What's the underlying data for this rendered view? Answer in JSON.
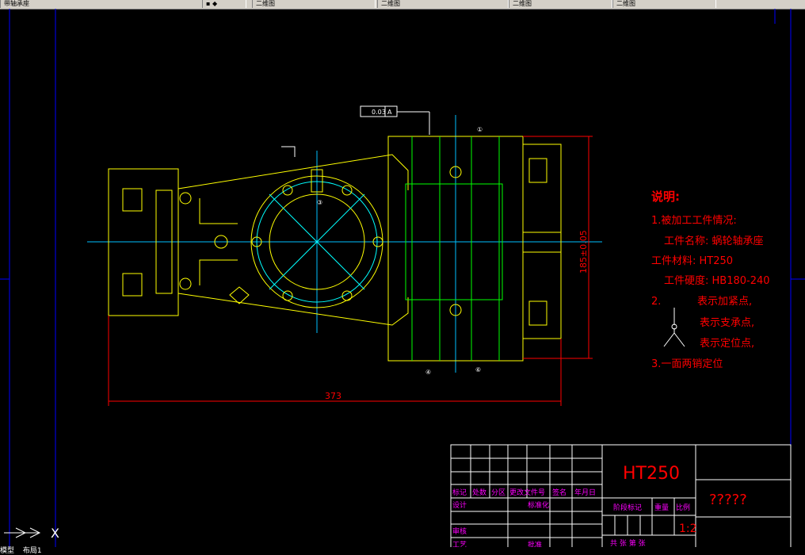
{
  "window_tabs": [
    {
      "label": "带轴承座"
    },
    {
      "label": "二维图"
    },
    {
      "label": "二维图"
    },
    {
      "label": "二维图"
    },
    {
      "label": "二维图"
    }
  ],
  "drawing": {
    "tolerance_frame": {
      "value": "0.03",
      "datum": "A"
    },
    "datum_marks": [
      "①",
      "④",
      "⑥",
      "③"
    ],
    "dimensions": {
      "overall_length": "373",
      "height": "185±0.05"
    }
  },
  "notes": {
    "heading": "说明:",
    "line1": "1.被加工工件情况:",
    "part_name": "工件名称: 蜗轮轴承座",
    "material": "工件材料: HT250",
    "hardness": "工件硬度: HB180-240",
    "item2": "2.",
    "clamp": "表示加紧点,",
    "support": "表示支承点,",
    "locate": "表示定位点,",
    "item3": "3.一面两销定位"
  },
  "title_block": {
    "material": "HT250",
    "drawing_name": "?????",
    "scale": "1:2",
    "row_headers": [
      "标记",
      "处数",
      "分区",
      "更改文件号",
      "签名",
      "年月日"
    ],
    "design": "设计",
    "standardize": "标准化",
    "review": "审核",
    "process": "工艺",
    "approve": "批准",
    "stage_mark": "阶段标记",
    "weight": "重量",
    "ratio": "比例",
    "sheets": "共  张  第  张"
  },
  "ucs": {
    "axis": "X"
  },
  "layout_tabs": [
    "模型",
    "布局1"
  ]
}
